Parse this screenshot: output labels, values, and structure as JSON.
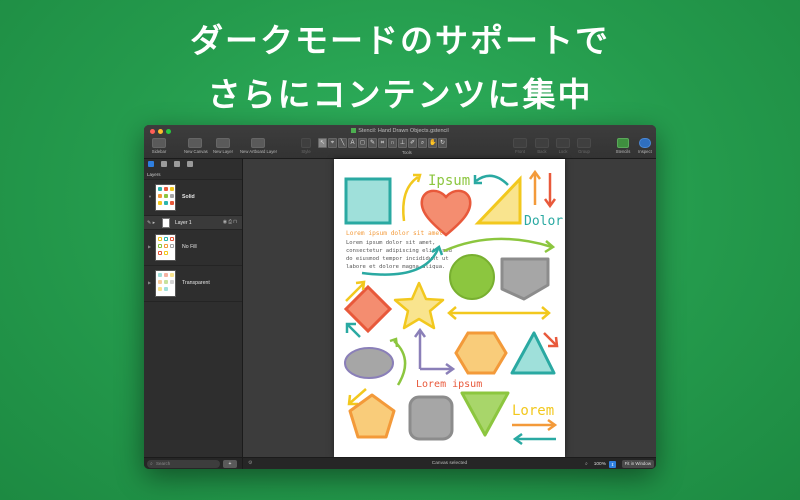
{
  "headline": {
    "line1": "ダークモードのサポートで",
    "line2": "さらにコンテンツに集中"
  },
  "window": {
    "title": "Stencil: Hand Drawn Objects.gstencil",
    "toolbar": {
      "sidebar": "Sidebar",
      "new_canvas": "New Canvas",
      "new_layer": "New Layer",
      "new_artboard_layer": "New Artboard Layer",
      "style": "Style",
      "tools": "Tools",
      "front": "Front",
      "back": "Back",
      "lock": "Lock",
      "group": "Group",
      "stencils": "Stencils",
      "inspect": "Inspect",
      "tool_icons": [
        "pointer-icon",
        "select-icon",
        "line-icon",
        "text-icon",
        "shape-icon",
        "pen-icon",
        "connect-icon",
        "magnet-icon",
        "diagram-icon",
        "style-icon",
        "zoom-icon",
        "hand-icon",
        "rotate-icon"
      ]
    },
    "sidebar": {
      "panel_title": "Layers",
      "tab_icons": [
        "canvases-icon",
        "layers-icon",
        "outline-icon",
        "selection-icon"
      ],
      "canvases": [
        {
          "label": "Solid"
        },
        {
          "label": "No Fill"
        },
        {
          "label": "Transparent"
        }
      ],
      "layer": {
        "label": "Layer 1"
      },
      "search_placeholder": "Search",
      "add_label": "+"
    },
    "canvas": {
      "texts": {
        "ipsum": "Ipsum",
        "dolor": "Dolor",
        "heading": "Lorem ipsum dolor sit amet",
        "body1": "Lorem ipsum dolor sit amet,",
        "body2": "consectetur adipiscing elit, sed",
        "body3": "do eiusmod tempor incididunt ut",
        "body4": "labore et dolore magna aliqua.",
        "lorem_ipsum": "Lorem ipsum",
        "lorem": "Lorem"
      }
    },
    "statusbar": {
      "status": "Canvas selected",
      "zoom": "100%",
      "fit_button": "Fit in Window"
    }
  },
  "colors": {
    "background": "#249a4c",
    "teal": "#2bb5ae",
    "yellow": "#f2c81e",
    "red": "#e8593b",
    "orange": "#f39a3a",
    "green": "#8cc63f",
    "gray": "#a6a6a6",
    "purple": "#8a7fb8"
  }
}
